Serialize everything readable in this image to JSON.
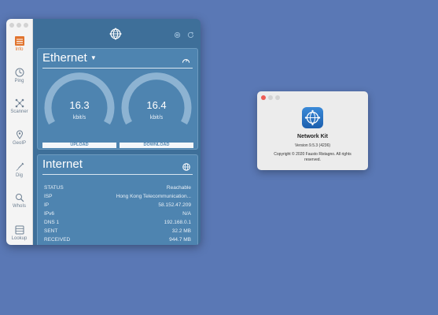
{
  "sidebar": {
    "items": [
      {
        "label": "Info",
        "icon": "info-icon"
      },
      {
        "label": "Ping",
        "icon": "ping-icon"
      },
      {
        "label": "Scanner",
        "icon": "scanner-icon"
      },
      {
        "label": "GeoIP",
        "icon": "location-pin-icon"
      },
      {
        "label": "Dig",
        "icon": "shovel-icon"
      },
      {
        "label": "WhoIs",
        "icon": "magnifier-icon"
      },
      {
        "label": "Lookup",
        "icon": "lookup-icon"
      }
    ]
  },
  "ethernet": {
    "title": "Ethernet",
    "upload": {
      "value": "16.3",
      "unit": "kbit/s",
      "label": "UPLOAD"
    },
    "download": {
      "value": "16.4",
      "unit": "kbit/s",
      "label": "DOWNLOAD"
    }
  },
  "internet": {
    "title": "Internet",
    "rows": [
      {
        "key": "STATUS",
        "value": "Reachable"
      },
      {
        "key": "ISP",
        "value": "Hong Kong Telecommunication..."
      },
      {
        "key": "IP",
        "value": "58.152.47.209"
      },
      {
        "key": "IPv6",
        "value": "N/A"
      },
      {
        "key": "DNS 1",
        "value": "192.168.0.1"
      },
      {
        "key": "SENT",
        "value": "32.2 MB"
      },
      {
        "key": "RECEIVED",
        "value": "944.7 MB"
      }
    ]
  },
  "about": {
    "app_name": "Network Kit",
    "version": "Version 9.5.3 (4236)",
    "copyright": "Copyright © 2020 Fausto Ristagno. All rights reserved."
  },
  "colors": {
    "desktop": "#5a78b5",
    "panel": "#4e84b0",
    "accent": "#e1742f"
  }
}
